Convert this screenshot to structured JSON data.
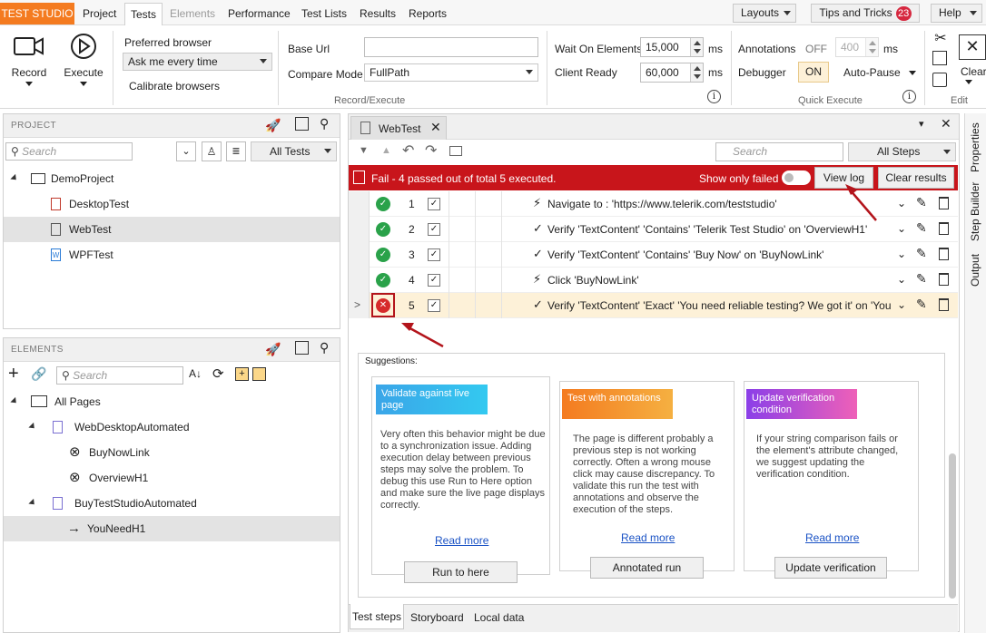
{
  "menubar": {
    "brand": "TEST STUDIO",
    "tabs": [
      "Project",
      "Tests",
      "Elements",
      "Performance",
      "Test Lists",
      "Results",
      "Reports"
    ],
    "layouts": "Layouts",
    "tips": "Tips and Tricks",
    "tips_count": "23",
    "help": "Help"
  },
  "ribbon": {
    "record": "Record",
    "execute": "Execute",
    "preferred_browser_label": "Preferred browser",
    "preferred_browser_value": "Ask me every time",
    "calibrate": "Calibrate browsers",
    "base_url_label": "Base Url",
    "base_url_value": "",
    "compare_mode_label": "Compare Mode",
    "compare_mode_value": "FullPath",
    "group_record_execute": "Record/Execute",
    "wait_label": "Wait On Elements",
    "wait_value": "15,000",
    "wait_unit": "ms",
    "client_ready_label": "Client Ready",
    "client_ready_value": "60,000",
    "client_ready_unit": "ms",
    "annotations_label": "Annotations",
    "annotations_state": "OFF",
    "annotations_value": "400",
    "annotations_unit": "ms",
    "debugger_label": "Debugger",
    "debugger_state": "ON",
    "autopause": "Auto-Pause",
    "group_quick_execute": "Quick Execute",
    "clear": "Clear",
    "group_edit": "Edit"
  },
  "project": {
    "header": "PROJECT",
    "search_placeholder": "Search",
    "filter": "All Tests",
    "items": [
      {
        "label": "DemoProject"
      },
      {
        "label": "DesktopTest"
      },
      {
        "label": "WebTest"
      },
      {
        "label": "WPFTest"
      }
    ]
  },
  "elements": {
    "header": "ELEMENTS",
    "search_placeholder": "Search",
    "items": [
      {
        "label": "All Pages"
      },
      {
        "label": "WebDesktopAutomated"
      },
      {
        "label": "BuyNowLink"
      },
      {
        "label": "OverviewH1"
      },
      {
        "label": "BuyTestStudioAutomated"
      },
      {
        "label": "YouNeedH1"
      }
    ]
  },
  "test": {
    "tab": "WebTest",
    "search_placeholder": "Search",
    "filter": "All Steps",
    "status_text": "Fail - 4 passed out of total 5 executed.",
    "show_only_failed": "Show only failed",
    "view_log": "View log",
    "clear_results": "Clear results",
    "steps": [
      {
        "num": "1",
        "status": "pass",
        "text": "Navigate to : 'https://www.telerik.com/teststudio'"
      },
      {
        "num": "2",
        "status": "pass",
        "text": "Verify 'TextContent' 'Contains' 'Telerik Test Studio' on 'OverviewH1'"
      },
      {
        "num": "3",
        "status": "pass",
        "text": "Verify 'TextContent' 'Contains' 'Buy Now' on 'BuyNowLink'"
      },
      {
        "num": "4",
        "status": "pass",
        "text": "Click 'BuyNowLink'"
      },
      {
        "num": "5",
        "status": "fail",
        "text": "Verify 'TextContent' 'Exact' 'You need reliable testing? We got it' on 'You"
      }
    ]
  },
  "suggestions": {
    "title": "Suggestions:",
    "cards": [
      {
        "tag": "Validate against live page",
        "body": "Very often this behavior might be due to a synchronization issue. Adding execution delay between previous steps may solve the problem. To debug this use Run to Here option and make sure the live page displays correctly.",
        "link": "Read more",
        "button": "Run to here"
      },
      {
        "tag": "Test with annotations",
        "body": "The page is different probably a previous step is not working correctly. Often a wrong mouse click may cause discrepancy. To validate this run the test with annotations and observe the execution of the steps.",
        "link": "Read more",
        "button": "Annotated run"
      },
      {
        "tag": "Update verification condition",
        "body": "If your string comparison fails or the element's attribute changed, we suggest updating the verification condition.",
        "link": "Read more",
        "button": "Update verification"
      }
    ]
  },
  "bottom_tabs": [
    "Test steps",
    "Storyboard",
    "Local data"
  ],
  "side_tabs": [
    "Properties",
    "Step Builder",
    "Output"
  ],
  "colors": {
    "brand": "#f47b20",
    "fail_bar": "#c8151b",
    "pass": "#2aa24a",
    "fail": "#d62b2b"
  }
}
